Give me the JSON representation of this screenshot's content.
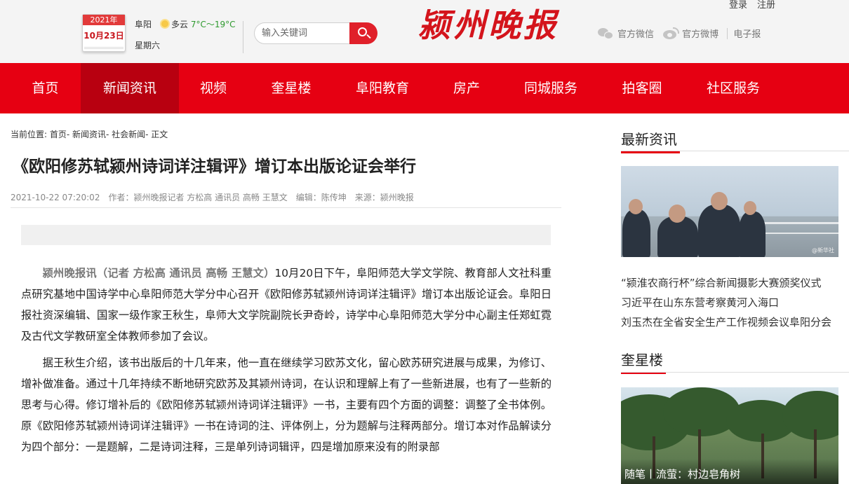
{
  "header": {
    "links": [
      "登录",
      "注册"
    ],
    "calendar": {
      "year": "2021年",
      "day": "10月23日"
    },
    "weather": {
      "city": "阜阳",
      "condition": "多云",
      "temp": "7°C～19°C",
      "weekday": "星期六"
    },
    "search": {
      "placeholder": "输入关键词"
    },
    "logo": "颍州晚报",
    "social": {
      "wechat": "官方微信",
      "weibo": "官方微博",
      "epaper": "电子报"
    }
  },
  "nav": {
    "items": [
      "首页",
      "新闻资讯",
      "视频",
      "奎星楼",
      "阜阳教育",
      "房产",
      "同城服务",
      "拍客圈",
      "社区服务"
    ],
    "active_index": 1
  },
  "article": {
    "breadcrumb": "当前位置: 首页- 新闻资讯- 社会新闻- 正文",
    "title": "《欧阳修苏轼颍州诗词详注辑评》增订本出版论证会举行",
    "meta": {
      "datetime": "2021-10-22 07:20:02",
      "author": "作者：颍州晚报记者 方松高 通讯员 高畅 王慧文",
      "editor": "编辑：陈传坤",
      "source": "来源：颍州晚报"
    },
    "lead": "颍州晚报讯（记者 方松高 通讯员 高畅 王慧文）",
    "paragraphs": [
      "10月20日下午，阜阳师范大学文学院、教育部人文社科重点研究基地中国诗学中心阜阳师范大学分中心召开《欧阳修苏轼颍州诗词详注辑评》增订本出版论证会。阜阳日报社资深编辑、国家一级作家王秋生，阜师大文学院副院长尹奇岭，诗学中心阜阳师范大学分中心副主任郑虹霓及古代文学教研室全体教师参加了会议。",
      "据王秋生介绍，该书出版后的十几年来，他一直在继续学习欧苏文化，留心欧苏研究进展与成果，为修订、增补做准备。通过十几年持续不断地研究欧苏及其颍州诗词，在认识和理解上有了一些新进展，也有了一些新的思考与心得。修订增补后的《欧阳修苏轼颍州诗词详注辑评》一书，主要有四个方面的调整：调整了全书体例。原《欧阳修苏轼颍州诗词详注辑评》一书在诗词的注、评体例上，分为题解与注释两部分。增订本对作品解读分为四个部分：一是题解，二是诗词注释，三是单列诗词辑评，四是增加原来没有的附录部"
    ]
  },
  "sidebar": {
    "latest": {
      "title": "最新资讯",
      "photo_watermark": "@新华社",
      "items": [
        "“颍淮农商行杯”综合新闻摄影大赛颁奖仪式",
        "习近平在山东东营考察黄河入海口",
        "刘玉杰在全省安全生产工作视频会议阜阳分会"
      ]
    },
    "kuixinglou": {
      "title": "奎星楼",
      "caption": "随笔丨流萤：村边皂角树"
    }
  },
  "colors": {
    "brand_red": "#e60012",
    "nav_active": "#b80010",
    "meta_gray": "#888888"
  }
}
